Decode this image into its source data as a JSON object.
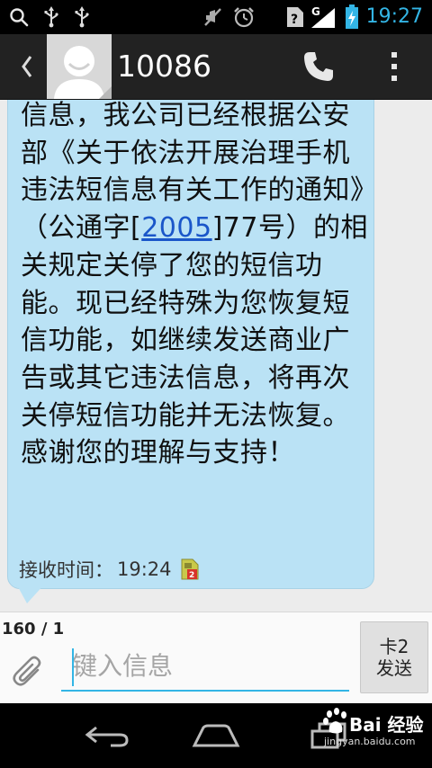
{
  "status_bar": {
    "time": "19:27",
    "icons": [
      "search-icon",
      "usb-icon",
      "usb-icon",
      "mute-icon",
      "alarm-icon",
      "no-sim-icon",
      "signal-icon",
      "battery-charging-icon"
    ],
    "network_label": "G",
    "accent_color": "#33b5e5"
  },
  "action_bar": {
    "title": "10086",
    "icons": [
      "back-icon",
      "contact-avatar",
      "phone-icon",
      "overflow-menu-icon"
    ]
  },
  "message": {
    "segments": [
      {
        "text": "信息，我公司已经根据公安部《关于依法开展治理手机违法短信息有关工作的通知》（公通字[",
        "link": false
      },
      {
        "text": "2005",
        "link": true
      },
      {
        "text": "]77号）的相关规定关停了您的短信功能。现已经特殊为您恢复短信功能，如继续发送商业广告或其它违法信息，将再次关停短信功能并无法恢复。感谢您的理解与支持！",
        "link": false
      }
    ],
    "received_label": "接收时间：",
    "received_time": "19:24",
    "sim_icon": "sim-card-2-icon",
    "bubble_color": "#bae2f5"
  },
  "compose": {
    "char_counter": "160 / 1",
    "placeholder": "键入信息",
    "value": "",
    "send_label_line1": "卡2",
    "send_label_line2": "发送",
    "attach_icon": "paperclip-icon"
  },
  "nav_bar": {
    "buttons": [
      "back-icon",
      "home-icon",
      "recent-apps-icon"
    ]
  },
  "watermark": {
    "text": "Bai 经验",
    "sub": "jingyan.baidu.com"
  }
}
